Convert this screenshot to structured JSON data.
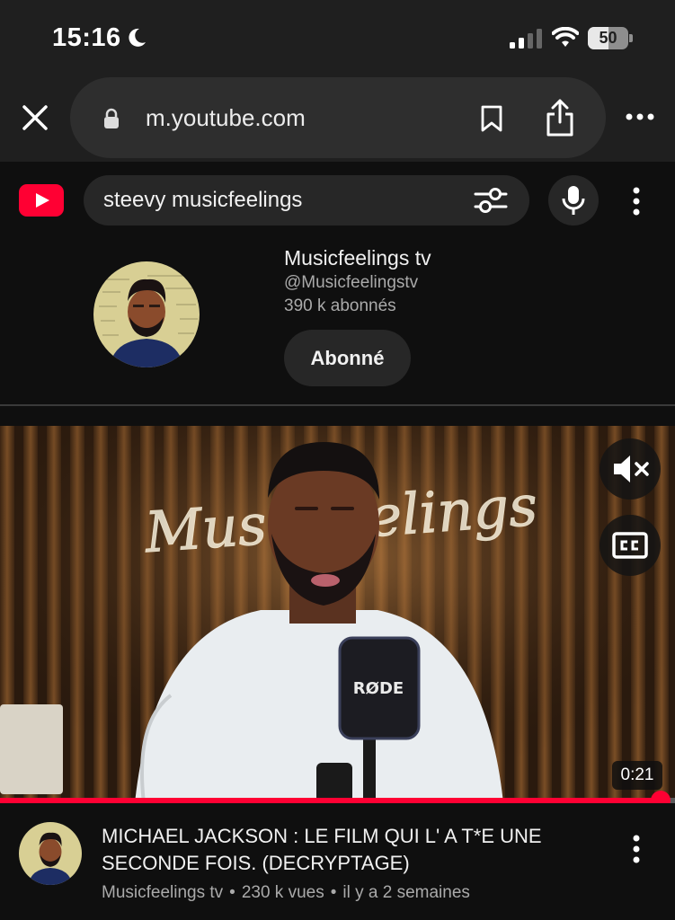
{
  "status_bar": {
    "time": "15:16",
    "battery_percent": 50,
    "battery_label": "50",
    "icons": [
      "moon-icon",
      "signal-icon",
      "wifi-icon",
      "battery-icon"
    ]
  },
  "browser": {
    "url": "m.youtube.com",
    "icons": [
      "close-icon",
      "lock-icon",
      "bookmark-icon",
      "share-icon",
      "more-horizontal-icon"
    ]
  },
  "youtube": {
    "search_query": "steevy musicfeelings",
    "icons": [
      "youtube-logo",
      "filter-icon",
      "mic-icon",
      "more-vertical-icon"
    ],
    "brand_color": "#ff0033"
  },
  "channel": {
    "name": "Musicfeelings tv",
    "handle": "@Musicfeelingstv",
    "subscribers": "390 k abonnés",
    "subscribe_label": "Abonné"
  },
  "video": {
    "duration": "0:21",
    "progress": 0.98,
    "neon_sign": "Musicfeelings",
    "mic_brand": "RØDE",
    "title": "MICHAEL JACKSON : LE FILM QUI L' A T*E UNE SECONDE FOIS. (DECRYPTAGE)",
    "channel": "Musicfeelings tv",
    "views": "230 k vues",
    "age": "il y a 2 semaines",
    "separator": "•",
    "icons": [
      "mute-icon",
      "captions-icon"
    ]
  }
}
